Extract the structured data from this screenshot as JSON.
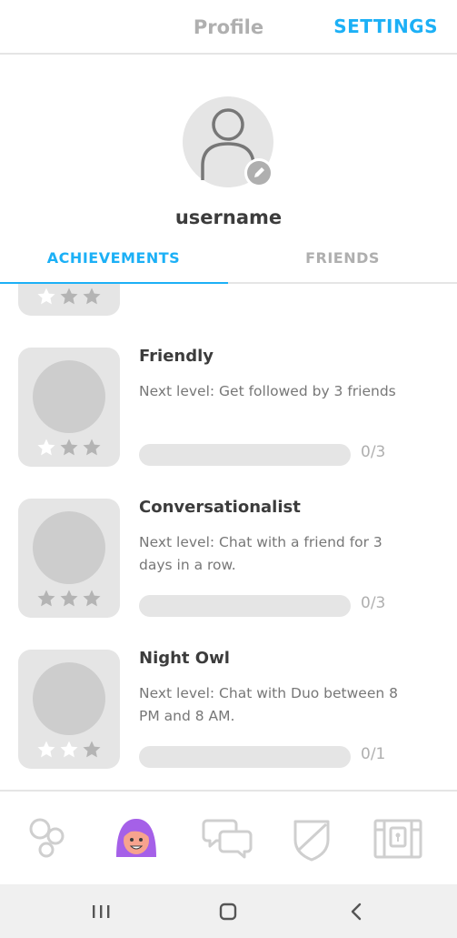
{
  "header": {
    "title": "Profile",
    "settings_label": "SETTINGS"
  },
  "profile": {
    "username": "username"
  },
  "tabs": [
    {
      "label": "ACHIEVEMENTS",
      "active": true
    },
    {
      "label": "FRIENDS",
      "active": false
    }
  ],
  "achievements": [
    {
      "title": "",
      "description": "",
      "progress_text": "",
      "stars_earned": 1
    },
    {
      "title": "Friendly",
      "description": "Next level: Get followed by 3 friends",
      "progress_text": "0/3",
      "progress": 0,
      "stars_earned": 1
    },
    {
      "title": "Conversationalist",
      "description": "Next level: Chat with a friend for 3 days in a row.",
      "progress_text": "0/3",
      "progress": 0,
      "stars_earned": 0
    },
    {
      "title": "Night Owl",
      "description": "Next level: Chat with Duo between 8 PM and 8 AM.",
      "progress_text": "0/1",
      "progress": 0,
      "stars_earned": 2
    }
  ],
  "bottom_nav": [
    {
      "icon": "bubbles-icon",
      "active": false
    },
    {
      "icon": "profile-character-icon",
      "active": true
    },
    {
      "icon": "chat-icon",
      "active": false
    },
    {
      "icon": "shield-icon",
      "active": false
    },
    {
      "icon": "shop-chest-icon",
      "active": false
    }
  ],
  "colors": {
    "accent": "#1cb0f6",
    "inactive": "#afafaf",
    "badge_bg": "#e5e5e5",
    "badge_circle": "#cdcdcd",
    "star_earned": "#ffffff",
    "star_empty": "#b4b4b4",
    "character_hair": "#a560e8"
  }
}
